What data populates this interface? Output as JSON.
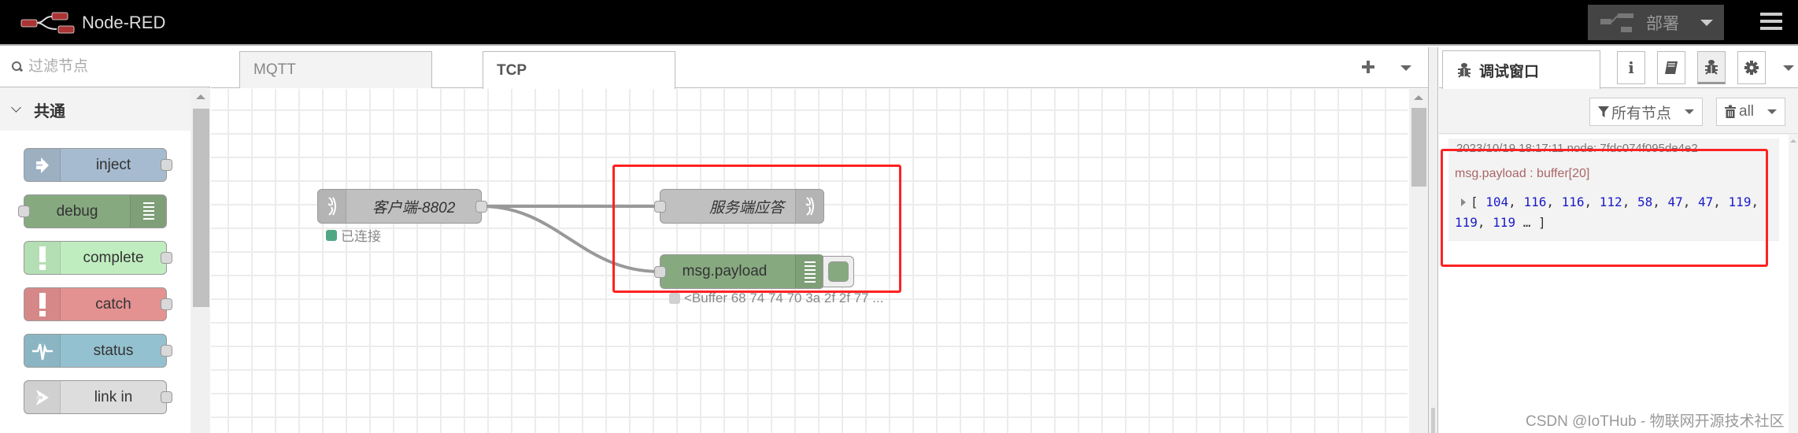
{
  "header": {
    "app_title": "Node-RED",
    "deploy_label": "部署",
    "logo_icon": "node-red-logo",
    "menu_icon": "hamburger-menu-icon"
  },
  "palette": {
    "search_placeholder": "过滤节点",
    "category": "共通",
    "nodes": [
      {
        "label": "inject",
        "color": "#a6bbcf",
        "icon": "arrow-right-icon"
      },
      {
        "label": "debug",
        "color": "#87a980",
        "icon": "list-icon"
      },
      {
        "label": "complete",
        "color": "#c0edc0",
        "icon": "exclamation-icon"
      },
      {
        "label": "catch",
        "color": "#e49191",
        "icon": "exclamation-icon"
      },
      {
        "label": "status",
        "color": "#94c1d0",
        "icon": "pulse-icon"
      },
      {
        "label": "link in",
        "color": "#dddddd",
        "icon": "link-in-icon"
      }
    ]
  },
  "workspace": {
    "tabs": [
      {
        "label": "MQTT",
        "active": false
      },
      {
        "label": "TCP",
        "active": true
      }
    ],
    "flow_nodes": {
      "tcp_client": {
        "label": "客户端-8802",
        "status": "已连接",
        "status_color": "#4fa883",
        "color": "#c0c0c0"
      },
      "tcp_response": {
        "label": "服务端应答",
        "color": "#c0c0c0"
      },
      "debug": {
        "label": "msg.payload",
        "status": "<Buffer 68 74 74 70 3a 2f 2f 77 ...",
        "status_color": "#d0d0d0",
        "color": "#87a980"
      }
    }
  },
  "sidebar": {
    "tab_label": "调试窗口",
    "tab_buttons": [
      "info-icon",
      "book-icon",
      "bug-icon",
      "gear-icon"
    ],
    "filter_label": "所有节点",
    "clear_label": "all",
    "messages": [
      {
        "meta": "2023/10/19 18:17:11   node: 7fdc074f095de4e2",
        "topic": "msg.payload : buffer[20]",
        "values": [
          "104",
          "116",
          "116",
          "112",
          "58",
          "47",
          "47",
          "119",
          "119",
          "119"
        ]
      }
    ]
  },
  "watermark": "CSDN @IoTHub - 物联网开源技术社区"
}
